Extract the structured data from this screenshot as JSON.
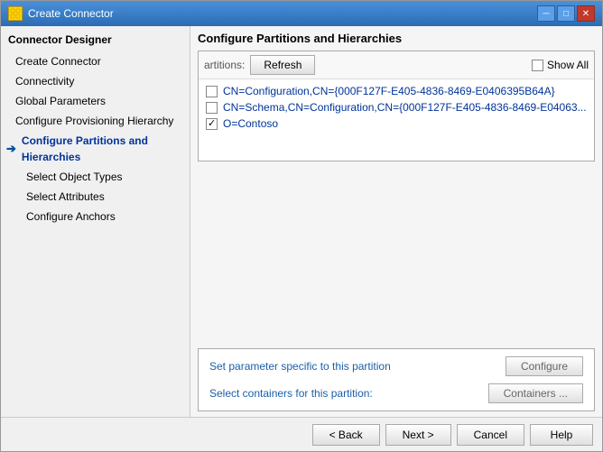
{
  "window": {
    "title": "Create Connector",
    "icon": "gear-icon"
  },
  "sidebar": {
    "header": "Connector Designer",
    "items": [
      {
        "id": "create-connector",
        "label": "Create Connector",
        "level": 1,
        "active": false,
        "disabled": false
      },
      {
        "id": "connectivity",
        "label": "Connectivity",
        "level": 1,
        "active": false,
        "disabled": false
      },
      {
        "id": "global-parameters",
        "label": "Global Parameters",
        "level": 1,
        "active": false,
        "disabled": false
      },
      {
        "id": "configure-provisioning",
        "label": "Configure Provisioning Hierarchy",
        "level": 1,
        "active": false,
        "disabled": false
      },
      {
        "id": "configure-partitions",
        "label": "Configure Partitions and Hierarchies",
        "level": 1,
        "active": true,
        "arrow": true,
        "disabled": false
      },
      {
        "id": "select-object-types",
        "label": "Select Object Types",
        "level": 2,
        "active": false,
        "disabled": false
      },
      {
        "id": "select-attributes",
        "label": "Select Attributes",
        "level": 2,
        "active": false,
        "disabled": false
      },
      {
        "id": "configure-anchors",
        "label": "Configure Anchors",
        "level": 2,
        "active": false,
        "disabled": false
      }
    ]
  },
  "main": {
    "panel_title": "Configure Partitions and Hierarchies",
    "toolbar": {
      "partitions_label": "artitions:",
      "refresh_btn": "Refresh",
      "show_all_label": "Show All"
    },
    "partitions": [
      {
        "id": "cn-config",
        "label": "CN=Configuration,CN={000F127F-E405-4836-8469-E0406395B64A}",
        "checked": false
      },
      {
        "id": "cn-schema",
        "label": "CN=Schema,CN=Configuration,CN={000F127F-E405-4836-8469-E04063...",
        "checked": false
      },
      {
        "id": "o-contoso",
        "label": "O=Contoso",
        "checked": true
      }
    ],
    "actions": [
      {
        "id": "set-parameter",
        "label": "Set parameter specific to this partition",
        "btn_label": "Configure"
      },
      {
        "id": "select-containers",
        "label": "Select containers for this partition:",
        "btn_label": "Containers ..."
      }
    ]
  },
  "footer": {
    "back_btn": "< Back",
    "next_btn": "Next >",
    "cancel_btn": "Cancel",
    "help_btn": "Help"
  }
}
